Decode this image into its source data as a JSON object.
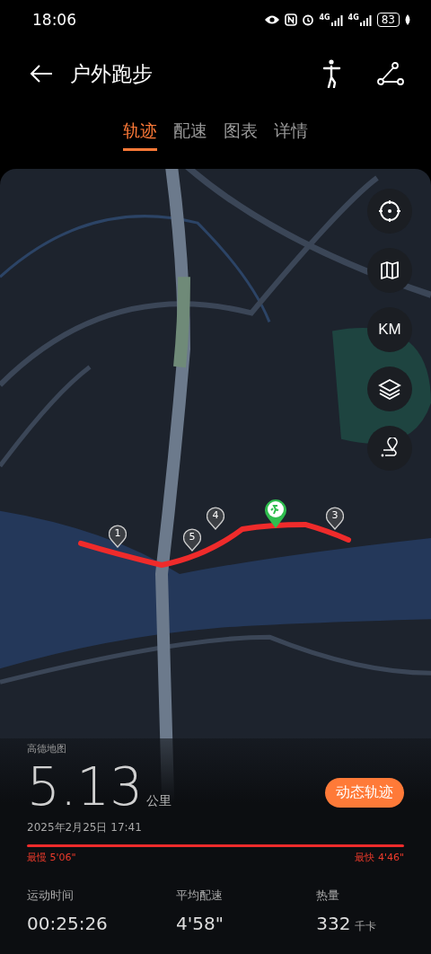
{
  "status_bar": {
    "time": "18:06",
    "networks": [
      "4G",
      "4G"
    ],
    "battery": "83"
  },
  "header": {
    "title": "户外跑步"
  },
  "tabs": [
    {
      "label": "轨迹",
      "selected": true
    },
    {
      "label": "配速",
      "selected": false
    },
    {
      "label": "图表",
      "selected": false
    },
    {
      "label": "详情",
      "selected": false
    }
  ],
  "map": {
    "controls": [
      {
        "kind": "locate"
      },
      {
        "kind": "map"
      },
      {
        "kind": "unit",
        "label": "KM"
      },
      {
        "kind": "layers"
      },
      {
        "kind": "route"
      }
    ],
    "km_markers": [
      {
        "label": "1"
      },
      {
        "label": "5"
      },
      {
        "label": "4"
      },
      {
        "label": "3"
      }
    ],
    "attribution": "高德地图"
  },
  "summary": {
    "distance": "5.13",
    "unit": "公里",
    "date": "2025年2月25日 17:41",
    "replay_button": "动态轨迹",
    "slowest": "最慢 5'06\"",
    "fastest": "最快 4'46\""
  },
  "metrics": [
    {
      "label": "运动时间",
      "value": "00:25:26"
    },
    {
      "label": "平均配速",
      "value": "4'58\""
    },
    {
      "label": "热量",
      "value": "332",
      "unit": "千卡"
    }
  ]
}
